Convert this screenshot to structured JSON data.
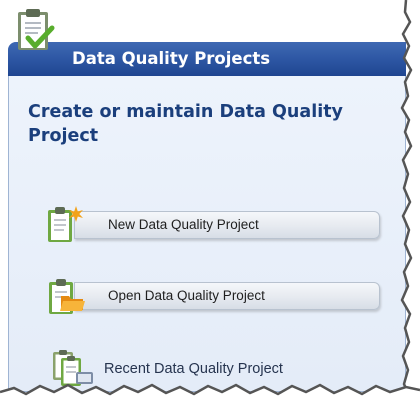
{
  "header": {
    "title": "Data Quality Projects"
  },
  "main": {
    "headline": "Create or maintain Data Quality Project",
    "actions": [
      {
        "label": "New Data Quality Project",
        "icon": "clipboard-new-icon"
      },
      {
        "label": "Open Data Quality Project",
        "icon": "clipboard-folder-icon"
      },
      {
        "label": "Recent Data Quality Project",
        "icon": "clipboard-stack-icon"
      }
    ]
  },
  "colors": {
    "header": "#2c55a2",
    "panel": "#e9f0fa",
    "headline": "#1b3f7c",
    "accent_green": "#6fb33a"
  }
}
